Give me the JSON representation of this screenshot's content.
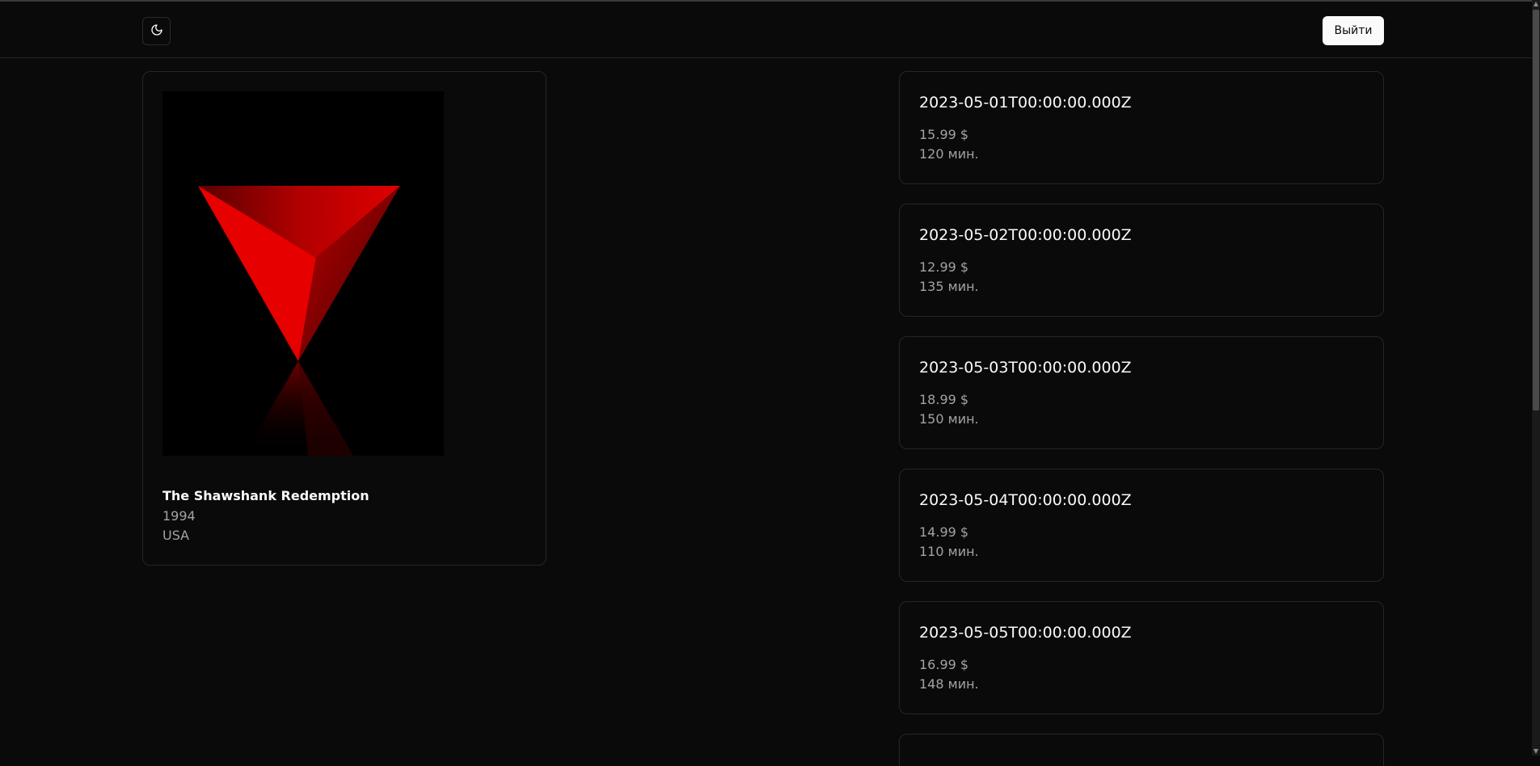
{
  "header": {
    "theme_icon": "moon-icon",
    "logout_label": "Выйти"
  },
  "movie": {
    "title": "The Shawshank Redemption",
    "year": "1994",
    "country": "USA"
  },
  "sessions": [
    {
      "date": "2023-05-01T00:00:00.000Z",
      "price": "15.99 $",
      "duration": "120 мин."
    },
    {
      "date": "2023-05-02T00:00:00.000Z",
      "price": "12.99 $",
      "duration": "135 мин."
    },
    {
      "date": "2023-05-03T00:00:00.000Z",
      "price": "18.99 $",
      "duration": "150 мин."
    },
    {
      "date": "2023-05-04T00:00:00.000Z",
      "price": "14.99 $",
      "duration": "110 мин."
    },
    {
      "date": "2023-05-05T00:00:00.000Z",
      "price": "16.99 $",
      "duration": "148 мин."
    }
  ],
  "colors": {
    "background": "#0a0a0a",
    "border": "#262626",
    "text_primary": "#fafafa",
    "text_muted": "#a3a3a3",
    "poster_red": "#e60000"
  }
}
